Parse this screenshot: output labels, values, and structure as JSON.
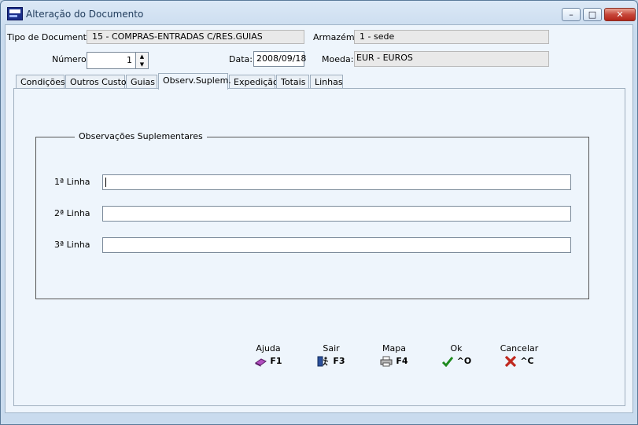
{
  "window": {
    "title": "Alteração do Documento",
    "min": "–",
    "max": "□",
    "close": "✕"
  },
  "header": {
    "tipo_label": "Tipo de Documento:",
    "tipo_value": "15 - COMPRAS-ENTRADAS C/RES.GUIAS",
    "armazem_label": "Armazém:",
    "armazem_value": "1 - sede",
    "numero_label": "Número:",
    "numero_value": "1",
    "data_label": "Data:",
    "data_value": "2008/09/18",
    "moeda_label": "Moeda:",
    "moeda_value": "EUR - EUROS"
  },
  "tabs": [
    "Condições",
    "Outros Custos",
    "Guias",
    "Observ.Suplem.",
    "Expedição",
    "Totais",
    "Linhas"
  ],
  "active_tab": "Observ.Suplem.",
  "group": {
    "title": "Observações Suplementares",
    "line1_label": "1ª Linha",
    "line2_label": "2ª Linha",
    "line3_label": "3ª Linha",
    "line1_value": "",
    "line2_value": "",
    "line3_value": ""
  },
  "buttons": {
    "ajuda": {
      "label": "Ajuda",
      "key": "F1",
      "icon": "book-icon"
    },
    "sair": {
      "label": "Sair",
      "key": "F3",
      "icon": "exit-door-icon"
    },
    "mapa": {
      "label": "Mapa",
      "key": "F4",
      "icon": "printer-icon"
    },
    "ok": {
      "label": "Ok",
      "key": "^O",
      "icon": "check-icon",
      "color": "#1e8a1e"
    },
    "cancelar": {
      "label": "Cancelar",
      "key": "^C",
      "icon": "cross-icon",
      "color": "#c0281e"
    }
  }
}
